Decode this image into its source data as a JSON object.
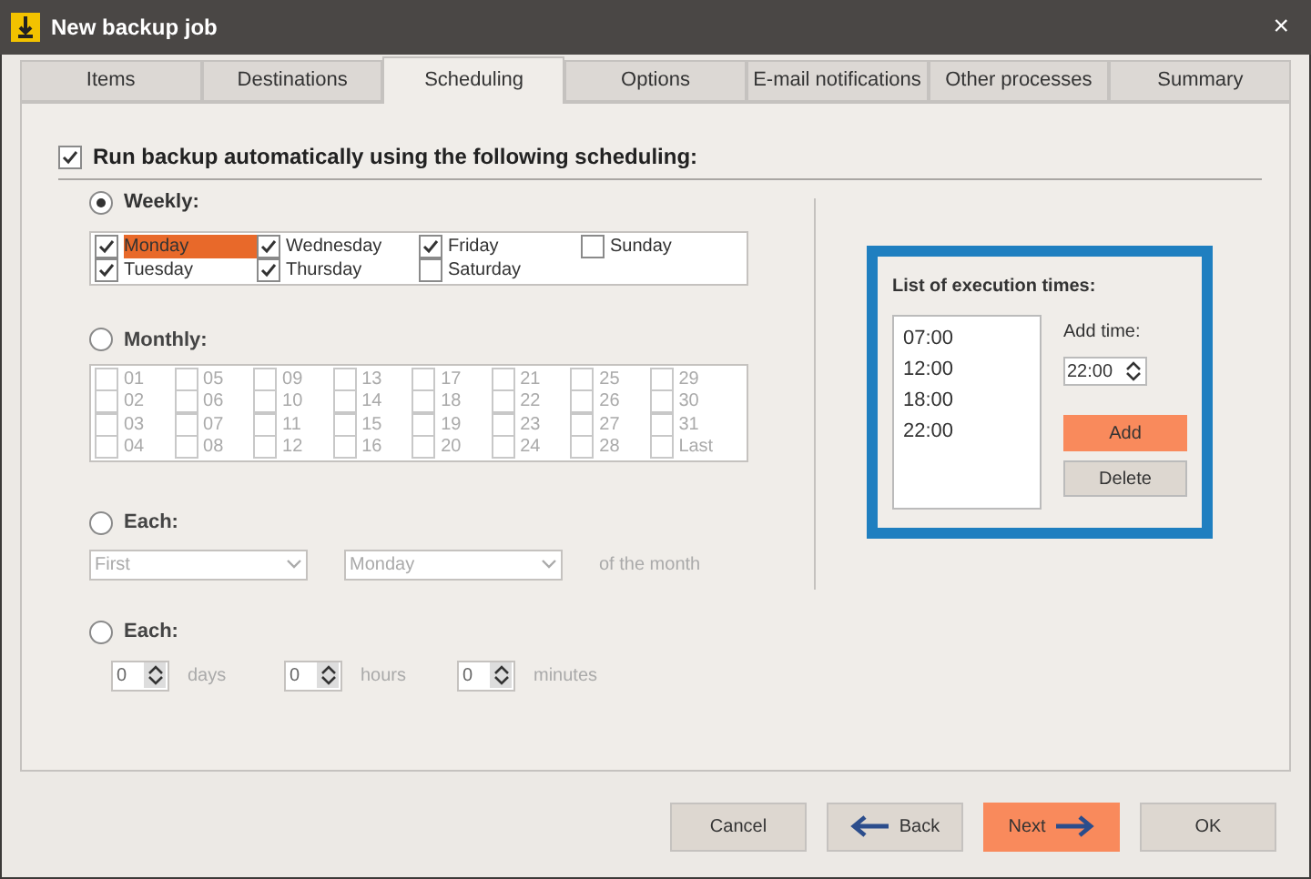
{
  "window": {
    "title": "New backup job",
    "close": "×"
  },
  "tabs": [
    {
      "label": "Items",
      "selected": false
    },
    {
      "label": "Destinations",
      "selected": false
    },
    {
      "label": "Scheduling",
      "selected": true
    },
    {
      "label": "Options",
      "selected": false
    },
    {
      "label": "E-mail notifications",
      "selected": false
    },
    {
      "label": "Other processes",
      "selected": false
    },
    {
      "label": "Summary",
      "selected": false
    }
  ],
  "run_automatically": {
    "label": "Run backup automatically using the following scheduling:",
    "checked": true
  },
  "weekly": {
    "label": "Weekly:",
    "selected": true,
    "disabled": false,
    "days": [
      {
        "label": "Monday",
        "checked": true,
        "highlighted": true
      },
      {
        "label": "Tuesday",
        "checked": true,
        "highlighted": false
      },
      {
        "label": "Wednesday",
        "checked": true,
        "highlighted": false
      },
      {
        "label": "Thursday",
        "checked": true,
        "highlighted": false
      },
      {
        "label": "Friday",
        "checked": true,
        "highlighted": false
      },
      {
        "label": "Saturday",
        "checked": false,
        "highlighted": false
      },
      {
        "label": "Sunday",
        "checked": false,
        "highlighted": false
      }
    ]
  },
  "monthly": {
    "label": "Monthly:",
    "selected": false,
    "disabled": true,
    "days": [
      {
        "label": "01",
        "checked": false
      },
      {
        "label": "02",
        "checked": false
      },
      {
        "label": "03",
        "checked": false
      },
      {
        "label": "04",
        "checked": false
      },
      {
        "label": "05",
        "checked": false
      },
      {
        "label": "06",
        "checked": false
      },
      {
        "label": "07",
        "checked": false
      },
      {
        "label": "08",
        "checked": false
      },
      {
        "label": "09",
        "checked": false
      },
      {
        "label": "10",
        "checked": false
      },
      {
        "label": "11",
        "checked": false
      },
      {
        "label": "12",
        "checked": false
      },
      {
        "label": "13",
        "checked": false
      },
      {
        "label": "14",
        "checked": false
      },
      {
        "label": "15",
        "checked": false
      },
      {
        "label": "16",
        "checked": false
      },
      {
        "label": "17",
        "checked": false
      },
      {
        "label": "18",
        "checked": false
      },
      {
        "label": "19",
        "checked": false
      },
      {
        "label": "20",
        "checked": false
      },
      {
        "label": "21",
        "checked": false
      },
      {
        "label": "22",
        "checked": false
      },
      {
        "label": "23",
        "checked": false
      },
      {
        "label": "24",
        "checked": false
      },
      {
        "label": "25",
        "checked": false
      },
      {
        "label": "26",
        "checked": false
      },
      {
        "label": "27",
        "checked": false
      },
      {
        "label": "28",
        "checked": false
      },
      {
        "label": "29",
        "checked": false
      },
      {
        "label": "30",
        "checked": false
      },
      {
        "label": "31",
        "checked": false
      },
      {
        "label": "Last",
        "checked": false
      }
    ]
  },
  "each_of_month": {
    "label": "Each:",
    "selected": false,
    "disabled": true,
    "ordinal": "First",
    "weekday": "Monday",
    "suffix": "of the month"
  },
  "each_interval": {
    "label": "Each:",
    "selected": false,
    "disabled": true,
    "fields": [
      {
        "value": "0",
        "unit": "days"
      },
      {
        "value": "0",
        "unit": "hours"
      },
      {
        "value": "0",
        "unit": "minutes"
      }
    ]
  },
  "execution_times": {
    "title": "List of execution times:",
    "times": [
      "07:00",
      "12:00",
      "18:00",
      "22:00"
    ],
    "add_time_label": "Add time:",
    "add_time_value": "22:00",
    "add_button": "Add",
    "delete_button": "Delete"
  },
  "footer": {
    "buttons": [
      {
        "label": "Cancel",
        "kind": "plain"
      },
      {
        "label": "Back",
        "kind": "back"
      },
      {
        "label": "Next",
        "kind": "next"
      },
      {
        "label": "OK",
        "kind": "plain"
      }
    ]
  }
}
